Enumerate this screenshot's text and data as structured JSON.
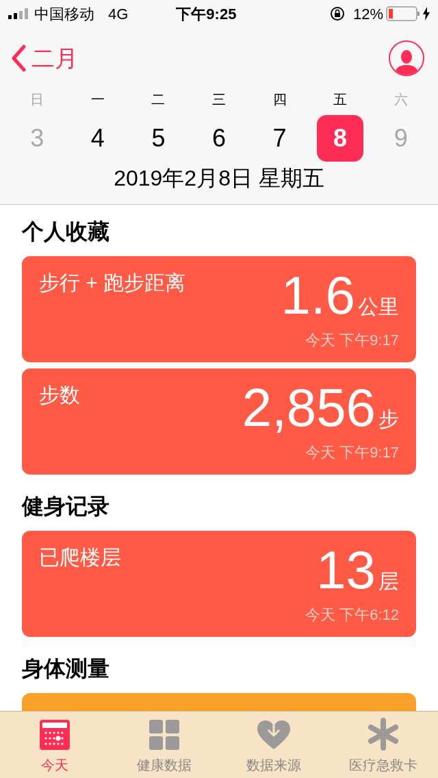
{
  "status_bar": {
    "carrier": "中国移动",
    "network": "4G",
    "time": "下午9:25",
    "battery": "12%"
  },
  "header": {
    "back": "二月"
  },
  "week": [
    {
      "weekday": "日",
      "date": "3",
      "dimmed": true,
      "selected": false
    },
    {
      "weekday": "一",
      "date": "4",
      "dimmed": false,
      "selected": false
    },
    {
      "weekday": "二",
      "date": "5",
      "dimmed": false,
      "selected": false
    },
    {
      "weekday": "三",
      "date": "6",
      "dimmed": false,
      "selected": false
    },
    {
      "weekday": "四",
      "date": "7",
      "dimmed": false,
      "selected": false
    },
    {
      "weekday": "五",
      "date": "8",
      "dimmed": false,
      "selected": true
    },
    {
      "weekday": "六",
      "date": "9",
      "dimmed": true,
      "selected": false
    }
  ],
  "date_label": "2019年2月8日 星期五",
  "sections": [
    {
      "title": "个人收藏",
      "cards": [
        {
          "color": "#ff5a45",
          "label": "步行 + 跑步距离",
          "value": "1.6",
          "unit": "公里",
          "time": "今天 下午9:17"
        },
        {
          "color": "#ff5a45",
          "label": "步数",
          "value": "2,856",
          "unit": "步",
          "time": "今天 下午9:17"
        }
      ]
    },
    {
      "title": "健身记录",
      "cards": [
        {
          "color": "#ff5a45",
          "label": "已爬楼层",
          "value": "13",
          "unit": "层",
          "time": "今天 下午6:12"
        }
      ]
    },
    {
      "title": "身体测量",
      "cards": [
        {
          "color": "#fba12a"
        }
      ]
    }
  ],
  "tabs": [
    {
      "label": "今天",
      "selected": true
    },
    {
      "label": "健康数据",
      "selected": false
    },
    {
      "label": "数据来源",
      "selected": false
    },
    {
      "label": "医疗急救卡",
      "selected": false
    }
  ]
}
